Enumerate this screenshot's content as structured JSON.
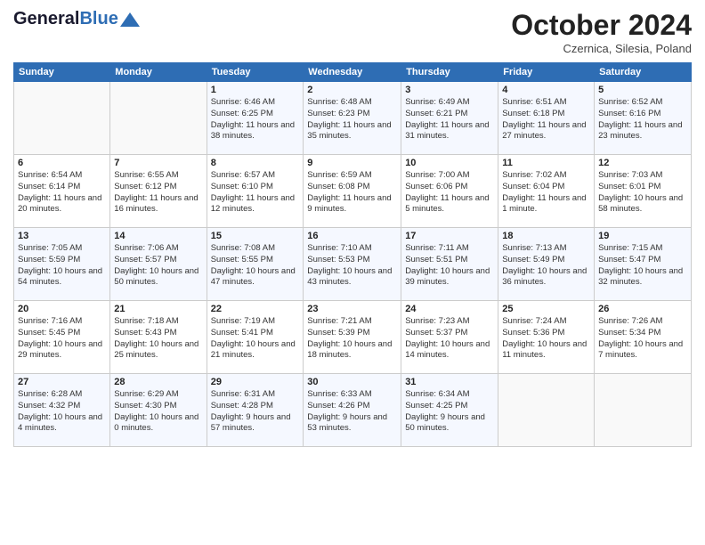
{
  "header": {
    "logo_general": "General",
    "logo_blue": "Blue",
    "month": "October 2024",
    "location": "Czernica, Silesia, Poland"
  },
  "weekdays": [
    "Sunday",
    "Monday",
    "Tuesday",
    "Wednesday",
    "Thursday",
    "Friday",
    "Saturday"
  ],
  "weeks": [
    [
      {
        "day": "",
        "info": ""
      },
      {
        "day": "",
        "info": ""
      },
      {
        "day": "1",
        "info": "Sunrise: 6:46 AM\nSunset: 6:25 PM\nDaylight: 11 hours and 38 minutes."
      },
      {
        "day": "2",
        "info": "Sunrise: 6:48 AM\nSunset: 6:23 PM\nDaylight: 11 hours and 35 minutes."
      },
      {
        "day": "3",
        "info": "Sunrise: 6:49 AM\nSunset: 6:21 PM\nDaylight: 11 hours and 31 minutes."
      },
      {
        "day": "4",
        "info": "Sunrise: 6:51 AM\nSunset: 6:18 PM\nDaylight: 11 hours and 27 minutes."
      },
      {
        "day": "5",
        "info": "Sunrise: 6:52 AM\nSunset: 6:16 PM\nDaylight: 11 hours and 23 minutes."
      }
    ],
    [
      {
        "day": "6",
        "info": "Sunrise: 6:54 AM\nSunset: 6:14 PM\nDaylight: 11 hours and 20 minutes."
      },
      {
        "day": "7",
        "info": "Sunrise: 6:55 AM\nSunset: 6:12 PM\nDaylight: 11 hours and 16 minutes."
      },
      {
        "day": "8",
        "info": "Sunrise: 6:57 AM\nSunset: 6:10 PM\nDaylight: 11 hours and 12 minutes."
      },
      {
        "day": "9",
        "info": "Sunrise: 6:59 AM\nSunset: 6:08 PM\nDaylight: 11 hours and 9 minutes."
      },
      {
        "day": "10",
        "info": "Sunrise: 7:00 AM\nSunset: 6:06 PM\nDaylight: 11 hours and 5 minutes."
      },
      {
        "day": "11",
        "info": "Sunrise: 7:02 AM\nSunset: 6:04 PM\nDaylight: 11 hours and 1 minute."
      },
      {
        "day": "12",
        "info": "Sunrise: 7:03 AM\nSunset: 6:01 PM\nDaylight: 10 hours and 58 minutes."
      }
    ],
    [
      {
        "day": "13",
        "info": "Sunrise: 7:05 AM\nSunset: 5:59 PM\nDaylight: 10 hours and 54 minutes."
      },
      {
        "day": "14",
        "info": "Sunrise: 7:06 AM\nSunset: 5:57 PM\nDaylight: 10 hours and 50 minutes."
      },
      {
        "day": "15",
        "info": "Sunrise: 7:08 AM\nSunset: 5:55 PM\nDaylight: 10 hours and 47 minutes."
      },
      {
        "day": "16",
        "info": "Sunrise: 7:10 AM\nSunset: 5:53 PM\nDaylight: 10 hours and 43 minutes."
      },
      {
        "day": "17",
        "info": "Sunrise: 7:11 AM\nSunset: 5:51 PM\nDaylight: 10 hours and 39 minutes."
      },
      {
        "day": "18",
        "info": "Sunrise: 7:13 AM\nSunset: 5:49 PM\nDaylight: 10 hours and 36 minutes."
      },
      {
        "day": "19",
        "info": "Sunrise: 7:15 AM\nSunset: 5:47 PM\nDaylight: 10 hours and 32 minutes."
      }
    ],
    [
      {
        "day": "20",
        "info": "Sunrise: 7:16 AM\nSunset: 5:45 PM\nDaylight: 10 hours and 29 minutes."
      },
      {
        "day": "21",
        "info": "Sunrise: 7:18 AM\nSunset: 5:43 PM\nDaylight: 10 hours and 25 minutes."
      },
      {
        "day": "22",
        "info": "Sunrise: 7:19 AM\nSunset: 5:41 PM\nDaylight: 10 hours and 21 minutes."
      },
      {
        "day": "23",
        "info": "Sunrise: 7:21 AM\nSunset: 5:39 PM\nDaylight: 10 hours and 18 minutes."
      },
      {
        "day": "24",
        "info": "Sunrise: 7:23 AM\nSunset: 5:37 PM\nDaylight: 10 hours and 14 minutes."
      },
      {
        "day": "25",
        "info": "Sunrise: 7:24 AM\nSunset: 5:36 PM\nDaylight: 10 hours and 11 minutes."
      },
      {
        "day": "26",
        "info": "Sunrise: 7:26 AM\nSunset: 5:34 PM\nDaylight: 10 hours and 7 minutes."
      }
    ],
    [
      {
        "day": "27",
        "info": "Sunrise: 6:28 AM\nSunset: 4:32 PM\nDaylight: 10 hours and 4 minutes."
      },
      {
        "day": "28",
        "info": "Sunrise: 6:29 AM\nSunset: 4:30 PM\nDaylight: 10 hours and 0 minutes."
      },
      {
        "day": "29",
        "info": "Sunrise: 6:31 AM\nSunset: 4:28 PM\nDaylight: 9 hours and 57 minutes."
      },
      {
        "day": "30",
        "info": "Sunrise: 6:33 AM\nSunset: 4:26 PM\nDaylight: 9 hours and 53 minutes."
      },
      {
        "day": "31",
        "info": "Sunrise: 6:34 AM\nSunset: 4:25 PM\nDaylight: 9 hours and 50 minutes."
      },
      {
        "day": "",
        "info": ""
      },
      {
        "day": "",
        "info": ""
      }
    ]
  ]
}
